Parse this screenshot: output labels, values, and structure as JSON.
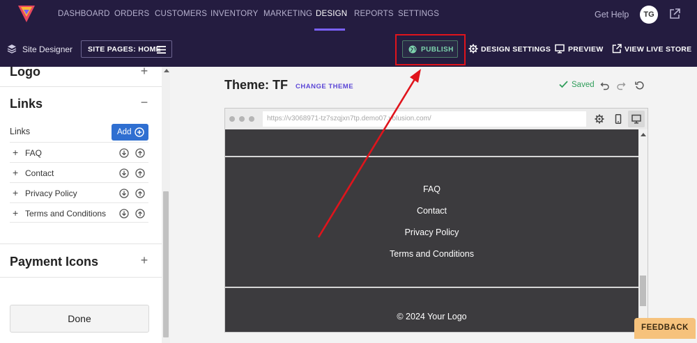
{
  "topnav": {
    "items": [
      {
        "label": "DASHBOARD",
        "active": false
      },
      {
        "label": "ORDERS",
        "active": false
      },
      {
        "label": "CUSTOMERS",
        "active": false
      },
      {
        "label": "INVENTORY",
        "active": false
      },
      {
        "label": "MARKETING",
        "active": false
      },
      {
        "label": "DESIGN",
        "active": true
      },
      {
        "label": "REPORTS",
        "active": false
      },
      {
        "label": "SETTINGS",
        "active": false
      }
    ],
    "get_help": "Get Help",
    "avatar_initials": "TG",
    "accent_color": "#7b61ff",
    "background_color": "#241c40"
  },
  "subbar": {
    "site_designer_label": "Site Designer",
    "site_pages_label": "SITE PAGES: HOME",
    "publish_label": "PUBLISH",
    "design_settings_label": "DESIGN SETTINGS",
    "preview_label": "PREVIEW",
    "view_live_store_label": "VIEW LIVE STORE"
  },
  "sidebar": {
    "sections": [
      {
        "title": "Logo",
        "toggle": "+"
      },
      {
        "title": "Links",
        "toggle": "−"
      },
      {
        "title": "Payment Icons",
        "toggle": "+"
      }
    ],
    "links_subheading": "Links",
    "add_label": "Add",
    "link_items": [
      "FAQ",
      "Contact",
      "Privacy Policy",
      "Terms and Conditions"
    ],
    "done_label": "Done"
  },
  "main": {
    "theme_title": "Theme: TF",
    "change_theme_label": "CHANGE THEME",
    "saved_label": "Saved",
    "saved_color": "#2f9d5a"
  },
  "preview": {
    "url": "https://v3068971-tz7szqjxn7tp.demo07.volusion.com/",
    "footer_links": [
      "FAQ",
      "Contact",
      "Privacy Policy",
      "Terms and Conditions"
    ],
    "copyright": "© 2024 Your Logo"
  },
  "feedback_label": "FEEDBACK",
  "icons": [
    "brand-logo-icon",
    "external-link-icon",
    "layers-icon",
    "menu-icon",
    "globe-icon",
    "gear-icon",
    "monitor-icon",
    "undo-icon",
    "redo-icon",
    "refresh-icon",
    "mobile-icon",
    "check-icon"
  ]
}
